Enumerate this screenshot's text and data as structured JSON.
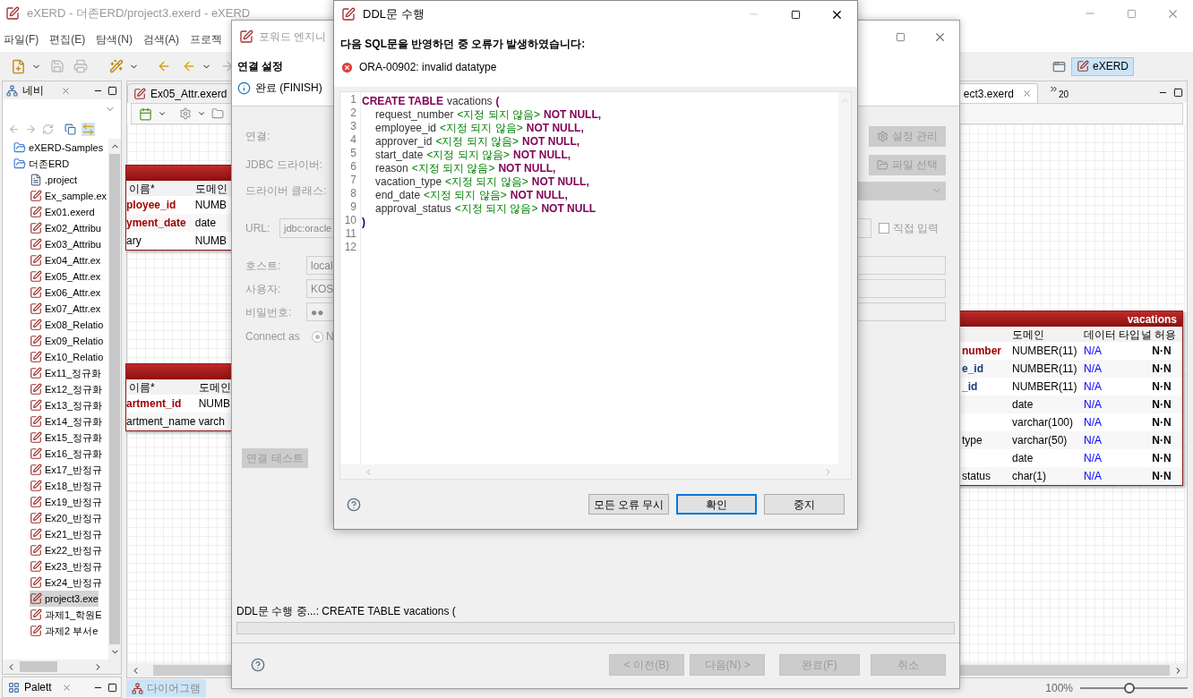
{
  "main_window": {
    "title": "eXERD - 더존ERD/project3.exerd - eXERD",
    "menu": [
      "파일(F)",
      "편집(E)",
      "탐색(N)",
      "검색(A)",
      "프로젝"
    ],
    "perspective": "eXERD"
  },
  "navigator": {
    "tab": "네비",
    "tree": [
      {
        "label": "eXERD-Samples",
        "kind": "folder"
      },
      {
        "label": "더존ERD",
        "kind": "folder",
        "children": [
          {
            "label": ".project",
            "kind": "file",
            "selected": false
          },
          {
            "label": "Ex_sample.ex",
            "kind": "erd",
            "selected": false
          },
          {
            "label": "Ex01.exerd",
            "kind": "erd",
            "selected": false
          },
          {
            "label": "Ex02_Attribu",
            "kind": "erd",
            "selected": false
          },
          {
            "label": "Ex03_Attribu",
            "kind": "erd",
            "selected": false
          },
          {
            "label": "Ex04_Attr.ex",
            "kind": "erd",
            "selected": false
          },
          {
            "label": "Ex05_Attr.ex",
            "kind": "erd",
            "selected": false
          },
          {
            "label": "Ex06_Attr.ex",
            "kind": "erd",
            "selected": false
          },
          {
            "label": "Ex07_Attr.ex",
            "kind": "erd",
            "selected": false
          },
          {
            "label": "Ex08_Relatio",
            "kind": "erd",
            "selected": false
          },
          {
            "label": "Ex09_Relatio",
            "kind": "erd",
            "selected": false
          },
          {
            "label": "Ex10_Relatio",
            "kind": "erd",
            "selected": false
          },
          {
            "label": "Ex11_정규화",
            "kind": "erd",
            "selected": false
          },
          {
            "label": "Ex12_정규화",
            "kind": "erd",
            "selected": false
          },
          {
            "label": "Ex13_정규화",
            "kind": "erd",
            "selected": false
          },
          {
            "label": "Ex14_정규화",
            "kind": "erd",
            "selected": false
          },
          {
            "label": "Ex15_정규화",
            "kind": "erd",
            "selected": false
          },
          {
            "label": "Ex16_정규화",
            "kind": "erd",
            "selected": false
          },
          {
            "label": "Ex17_반정규",
            "kind": "erd",
            "selected": false
          },
          {
            "label": "Ex18_반정규",
            "kind": "erd",
            "selected": false
          },
          {
            "label": "Ex19_반정규",
            "kind": "erd",
            "selected": false
          },
          {
            "label": "Ex20_반정규",
            "kind": "erd",
            "selected": false
          },
          {
            "label": "Ex21_반정규",
            "kind": "erd",
            "selected": false
          },
          {
            "label": "Ex22_반정규",
            "kind": "erd",
            "selected": false
          },
          {
            "label": "Ex23_반정규",
            "kind": "erd",
            "selected": false
          },
          {
            "label": "Ex24_반정규",
            "kind": "erd",
            "selected": false
          },
          {
            "label": "project3.exe",
            "kind": "erd",
            "selected": true
          },
          {
            "label": "과제1_학원E",
            "kind": "erd",
            "selected": false
          },
          {
            "label": "과제2 부서e",
            "kind": "erd",
            "selected": false
          }
        ]
      }
    ]
  },
  "palette": {
    "tab": "Palett"
  },
  "editor": {
    "tabs": [
      {
        "label": "Ex05_Attr.exerd",
        "selected": false
      },
      {
        "label": "ect3.exerd",
        "selected": true
      }
    ],
    "overflow": "20",
    "bottom_tab": "다이어그램",
    "zoom": "100%",
    "zoom_slider": {
      "level": 0.46
    },
    "tables": [
      {
        "name_header": "이름*",
        "columns": [
          "도메인"
        ],
        "rows": [
          {
            "name": "ployee_id",
            "domain": "NUMB",
            "kind": "pk"
          },
          {
            "name": "yment_date",
            "domain": "date",
            "kind": "pk"
          },
          {
            "name": "ary",
            "domain": "NUMB",
            "kind": "normal"
          }
        ]
      },
      {
        "name_header": "이름*",
        "columns": [
          "도메인"
        ],
        "rows": [
          {
            "name": "artment_id",
            "domain": "NUMB",
            "kind": "pk"
          },
          {
            "name": "artment_name",
            "domain": "varch",
            "kind": "normal"
          }
        ]
      },
      {
        "title": "vacations",
        "columns": [
          "도메인",
          "데이터 타입",
          "널 허용"
        ],
        "rows": [
          {
            "name": "number",
            "domain": "NUMBER(11)",
            "type": "N/A",
            "nullable": "N·N",
            "kind": "pk"
          },
          {
            "name": "e_id",
            "domain": "NUMBER(11)",
            "type": "N/A",
            "nullable": "N·N",
            "kind": "fk"
          },
          {
            "name": "_id",
            "domain": "NUMBER(11)",
            "type": "N/A",
            "nullable": "N·N",
            "kind": "fk"
          },
          {
            "domain": "date",
            "type": "N/A",
            "nullable": "N·N"
          },
          {
            "domain": "varchar(100)",
            "type": "N/A",
            "nullable": "N·N"
          },
          {
            "name": "type",
            "domain": "varchar(50)",
            "type": "N/A",
            "nullable": "N·N",
            "kind": "normal"
          },
          {
            "domain": "date",
            "type": "N/A",
            "nullable": "N·N"
          },
          {
            "name": "status",
            "domain": "char(1)",
            "type": "N/A",
            "nullable": "N·N",
            "kind": "normal"
          }
        ]
      }
    ]
  },
  "wizard": {
    "title": "포워드 엔지니",
    "heading": "연결 설정",
    "info": "완료 (FINISH)",
    "labels": [
      "연결:",
      "JDBC 드라이버:",
      "드라이버 클래스:"
    ],
    "side_buttons": [
      {
        "label": "설정 관리",
        "disabled": true
      },
      {
        "label": "파일 선택",
        "disabled": true
      }
    ],
    "url": {
      "label": "URL:",
      "value": "jdbc:oracle"
    },
    "direct_input": {
      "label": "직접 입력",
      "checked": false
    },
    "fields": [
      {
        "label": "호스트:",
        "value": "local"
      },
      {
        "label": "사용자:",
        "value": "KOS"
      },
      {
        "label": "비밀번호:",
        "value": "●●"
      }
    ],
    "connect_as": {
      "label": "Connect as",
      "option": "N",
      "selected": true
    },
    "test_button": {
      "label": "연결 테스트",
      "disabled": true
    },
    "status": "DDL문 수행 중...: CREATE TABLE vacations (",
    "progress": {
      "level": 0
    },
    "buttons": [
      {
        "label": "< 이전(B)",
        "disabled": true
      },
      {
        "label": "다음(N) >",
        "disabled": true
      },
      {
        "label": "완료(F)",
        "disabled": true
      },
      {
        "label": "취소",
        "disabled": true
      }
    ]
  },
  "ddl_dialog": {
    "title": "DDL문 수행",
    "message": "다음 SQL문을 반영하던 중 오류가 발생하였습니다:",
    "error": "ORA-00902: invalid datatype",
    "code": [
      {
        "number": "1",
        "tokens": [
          {
            "kind": "keyword",
            "text": "CREATE TABLE"
          },
          {
            "kind": "name",
            "text": "vacations"
          },
          {
            "kind": "keyword",
            "text": "("
          }
        ]
      },
      {
        "number": "2",
        "tokens": [
          {
            "kind": "name",
            "text": "request_number"
          },
          {
            "kind": "type",
            "text": "<지정 되지 않음>"
          },
          {
            "kind": "keyword",
            "text": "NOT NULL,"
          }
        ]
      },
      {
        "number": "3",
        "tokens": [
          {
            "kind": "name",
            "text": "employee_id"
          },
          {
            "kind": "type",
            "text": "<지정 되지 않음>"
          },
          {
            "kind": "keyword",
            "text": "NOT NULL,"
          }
        ]
      },
      {
        "number": "4",
        "tokens": [
          {
            "kind": "name",
            "text": "approver_id"
          },
          {
            "kind": "type",
            "text": "<지정 되지 않음>"
          },
          {
            "kind": "keyword",
            "text": "NOT NULL,"
          }
        ]
      },
      {
        "number": "5",
        "tokens": [
          {
            "kind": "name",
            "text": "start_date"
          },
          {
            "kind": "type",
            "text": "<지정 되지 않음>"
          },
          {
            "kind": "keyword",
            "text": "NOT NULL,"
          }
        ]
      },
      {
        "number": "6",
        "tokens": [
          {
            "kind": "name",
            "text": "reason"
          },
          {
            "kind": "type",
            "text": "<지정 되지 않음>"
          },
          {
            "kind": "keyword",
            "text": "NOT NULL,"
          }
        ]
      },
      {
        "number": "7",
        "tokens": [
          {
            "kind": "name",
            "text": "vacation_type"
          },
          {
            "kind": "type",
            "text": "<지정 되지 않음>"
          },
          {
            "kind": "keyword",
            "text": "NOT NULL,"
          }
        ]
      },
      {
        "number": "8",
        "tokens": [
          {
            "kind": "name",
            "text": "end_date"
          },
          {
            "kind": "type",
            "text": "<지정 되지 않음>"
          },
          {
            "kind": "keyword",
            "text": "NOT NULL,"
          }
        ]
      },
      {
        "number": "9",
        "tokens": [
          {
            "kind": "name",
            "text": "approval_status"
          },
          {
            "kind": "type",
            "text": "<지정 되지 않음>"
          },
          {
            "kind": "keyword",
            "text": "NOT NULL"
          }
        ]
      },
      {
        "number": "10",
        "tokens": [
          {
            "kind": "paren",
            "text": ")"
          }
        ]
      },
      {
        "number": "11"
      },
      {
        "number": "12"
      }
    ],
    "buttons": [
      {
        "label": "모든 오류 무시",
        "selected": false
      },
      {
        "label": "확인",
        "selected": true
      },
      {
        "label": "중지",
        "selected": false
      }
    ]
  }
}
